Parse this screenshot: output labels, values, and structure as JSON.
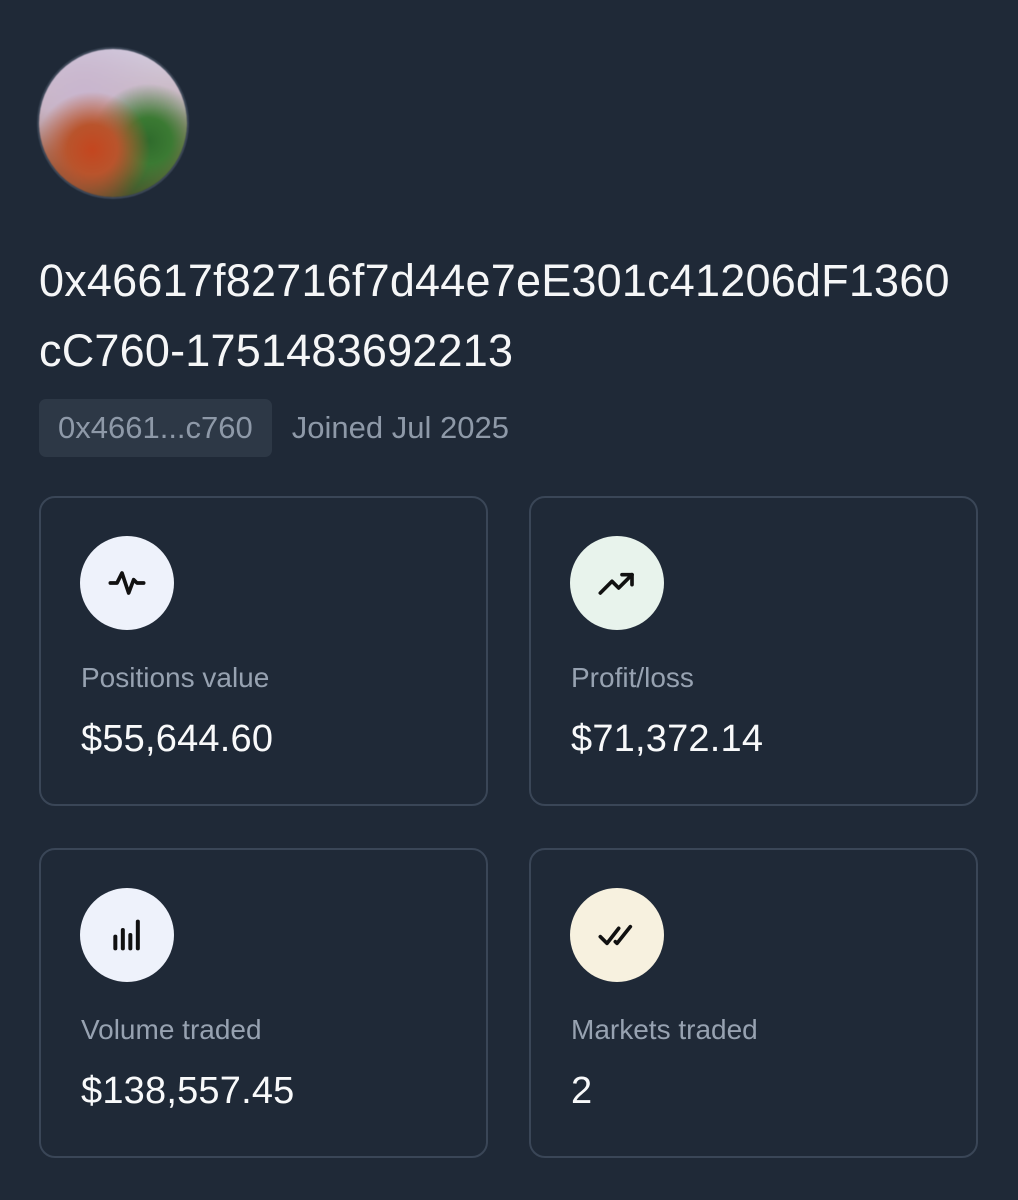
{
  "profile": {
    "name": "0x46617f82716f7d44e7eE301c41206dF1360cC760-1751483692213",
    "short_address": "0x4661...c760",
    "joined": "Joined Jul 2025"
  },
  "stats": [
    {
      "label": "Positions value",
      "value": "$55,644.60",
      "icon": "activity-icon",
      "icon_bg": "#eef2fb"
    },
    {
      "label": "Profit/loss",
      "value": "$71,372.14",
      "icon": "trending-up-icon",
      "icon_bg": "#e8f3ec"
    },
    {
      "label": "Volume traded",
      "value": "$138,557.45",
      "icon": "bar-chart-icon",
      "icon_bg": "#eef2fb"
    },
    {
      "label": "Markets traded",
      "value": "2",
      "icon": "double-check-icon",
      "icon_bg": "#f7f1df"
    }
  ],
  "colors": {
    "background": "#1f2937",
    "card_border": "#3a4657",
    "muted_text": "#97a2b1"
  }
}
